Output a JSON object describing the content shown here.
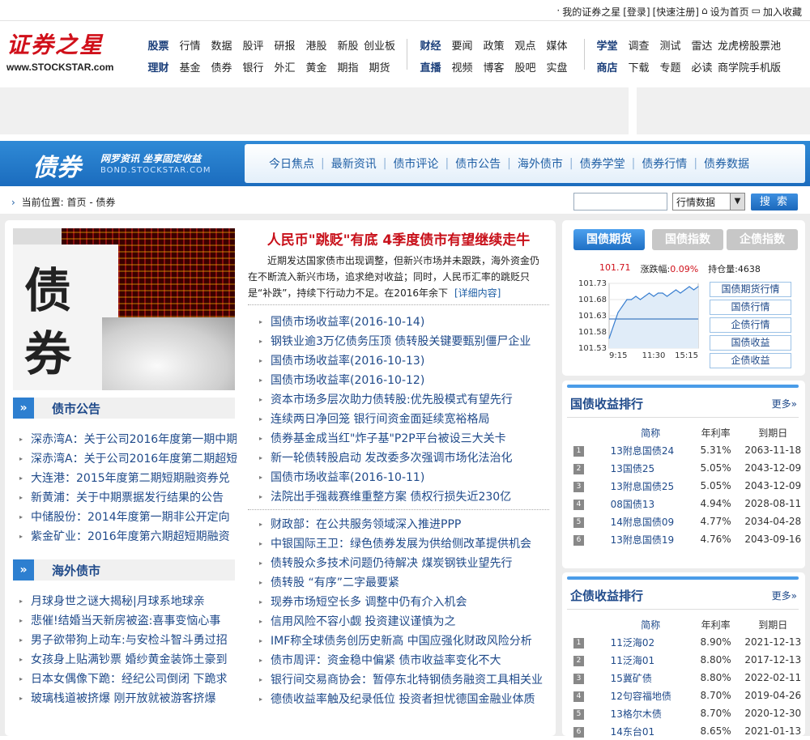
{
  "topbar": {
    "my_account": "我的证券之星",
    "login": "[登录]",
    "register": "[快速注册]",
    "set_home": "设为首页",
    "bookmark": "加入收藏"
  },
  "logo": {
    "name": "证券之星",
    "url": "www.STOCKSTAR.com"
  },
  "nav": {
    "group1": [
      {
        "label": "股票",
        "bold": true
      },
      {
        "label": "行情"
      },
      {
        "label": "数据"
      },
      {
        "label": "股评"
      },
      {
        "label": "研报"
      },
      {
        "label": "港股"
      },
      {
        "label": "新股"
      },
      {
        "label": "创业板"
      },
      {
        "label": "理财",
        "bold": true
      },
      {
        "label": "基金"
      },
      {
        "label": "债券"
      },
      {
        "label": "银行"
      },
      {
        "label": "外汇"
      },
      {
        "label": "黄金"
      },
      {
        "label": "期指"
      },
      {
        "label": "期货"
      }
    ],
    "group2": [
      {
        "label": "财经",
        "bold": true
      },
      {
        "label": "要闻"
      },
      {
        "label": "政策"
      },
      {
        "label": "观点"
      },
      {
        "label": "媒体"
      },
      {
        "label": "直播",
        "bold": true
      },
      {
        "label": "视频"
      },
      {
        "label": "博客"
      },
      {
        "label": "股吧"
      },
      {
        "label": "实盘"
      }
    ],
    "group3": [
      {
        "label": "学堂",
        "bold": true
      },
      {
        "label": "调查"
      },
      {
        "label": "测试"
      },
      {
        "label": "雷达"
      },
      {
        "label": "龙虎榜"
      },
      {
        "label": "股票池"
      },
      {
        "label": "商店",
        "bold": true
      },
      {
        "label": "下载"
      },
      {
        "label": "专题"
      },
      {
        "label": "必读"
      },
      {
        "label": "商学院"
      },
      {
        "label": "手机版"
      }
    ]
  },
  "channel": {
    "title": "债券",
    "slogan": "网罗资讯 坐享固定收益",
    "url": "BOND.STOCKSTAR.COM",
    "menu": [
      "今日焦点",
      "最新资讯",
      "债市评论",
      "债市公告",
      "海外债市",
      "债券学堂",
      "债券行情",
      "债券数据"
    ]
  },
  "breadcrumb": {
    "label": "当前位置:",
    "path": "首页 - 债券"
  },
  "search": {
    "placeholder": "",
    "select_value": "行情数据",
    "button": "搜 索"
  },
  "hero": {
    "headline": "人民币\"跳贬\"有底 4季度债市有望继续走牛",
    "summary": "近期发达国家债市出现调整，但新兴市场并未跟跌，海外资金仍在不断流入新兴市场，追求绝对收益；同时，人民币汇率的跳贬只是“补跌”，持续下行动力不足。在2016年余下",
    "more": "[详细内容]"
  },
  "news_top": [
    "国债市场收益率(2016-10-14)",
    "钢铁业逾3万亿债务压顶 债转股关键要甄别僵尸企业",
    "国债市场收益率(2016-10-13)",
    "国债市场收益率(2016-10-12)",
    "资本市场多层次助力债转股:优先股模式有望先行",
    "连续两日净回笼 银行间资金面延续宽裕格局",
    "债券基金成当红\"炸子基\"P2P平台被设三大关卡",
    "新一轮债转股启动 发改委多次强调市场化法治化",
    "国债市场收益率(2016-10-11)",
    "法院出手强裁赛维重整方案 债权行损失近230亿"
  ],
  "news_bottom": [
    "财政部：在公共服务领域深入推进PPP",
    "中银国际王卫：绿色债券发展为供给侧改革提供机会",
    "债转股众多技术问题仍待解决 煤炭钢铁业望先行",
    "债转股 “有序”二字最要紧",
    "现券市场短空长多 调整中仍有介入机会",
    "信用风险不容小觑 投资建议谨慎为之",
    "IMF称全球债务创历史新高 中国应强化财政风险分析",
    "债市周评：资金稳中偏紧 债市收益率变化不大",
    "银行间交易商协会：暂停东北特钢债务融资工具相关业",
    "德债收益率触及纪录低位 投资者担忧德国金融业体质"
  ],
  "announcements": {
    "title": "债市公告",
    "items": [
      "深赤湾A：关于公司2016年度第一期中期",
      "深赤湾A：关于公司2016年度第二期超短",
      "大连港：2015年度第二期短期融资券兑",
      "新黄浦：关于中期票据发行结果的公告",
      "中储股份：2014年度第一期非公开定向",
      "紫金矿业：2016年度第六期超短期融资"
    ]
  },
  "overseas": {
    "title": "海外债市",
    "items": [
      "月球身世之谜大揭秘|月球系地球亲",
      "悲催!结婚当天新房被盗:喜事变恼心事",
      "男子欲带狗上动车:与安检斗智斗勇过招",
      "女孩身上贴满钞票 婚纱黄金装饰土豪到",
      "日本女偶像下跪：经纪公司倒闭 下跪求",
      "玻璃栈道被挤爆 刚开放就被游客挤爆"
    ]
  },
  "quote": {
    "tabs": [
      "国债期货",
      "国债指数",
      "企债指数"
    ],
    "price": "101.71",
    "change_label": "涨跌幅:",
    "change": "0.09%",
    "oi_label": "持仓量:",
    "oi": "4638",
    "links": [
      "国债期货行情",
      "国债行情",
      "企债行情",
      "国债收益",
      "企债收益"
    ]
  },
  "chart_data": {
    "type": "line",
    "title": "",
    "y_ticks": [
      "101.73",
      "101.68",
      "101.63",
      "101.58",
      "101.53"
    ],
    "ylim": [
      101.53,
      101.73
    ],
    "x_ticks": [
      "9:15",
      "11:30",
      "15:15"
    ],
    "reference": 101.62,
    "x": [
      0,
      5,
      10,
      15,
      20,
      25,
      30,
      35,
      40,
      45,
      50,
      55,
      60,
      65,
      70,
      75,
      80,
      85,
      90,
      95,
      100
    ],
    "values": [
      101.56,
      101.6,
      101.64,
      101.66,
      101.68,
      101.68,
      101.69,
      101.68,
      101.69,
      101.7,
      101.69,
      101.7,
      101.7,
      101.69,
      101.7,
      101.71,
      101.7,
      101.71,
      101.72,
      101.71,
      101.72
    ],
    "colors": {
      "line": "#3a7fd0",
      "fill": "#e0ecf8",
      "ref": "#1a5fb4"
    }
  },
  "gov_rank": {
    "title": "国债收益排行",
    "more": "更多»",
    "headers": [
      "简称",
      "年利率",
      "到期日"
    ],
    "rows": [
      {
        "n": "1",
        "name": "13附息国债24",
        "rate": "5.31%",
        "date": "2063-11-18"
      },
      {
        "n": "2",
        "name": "13国债25",
        "rate": "5.05%",
        "date": "2043-12-09"
      },
      {
        "n": "3",
        "name": "13附息国债25",
        "rate": "5.05%",
        "date": "2043-12-09"
      },
      {
        "n": "4",
        "name": "08国债13",
        "rate": "4.94%",
        "date": "2028-08-11"
      },
      {
        "n": "5",
        "name": "14附息国债09",
        "rate": "4.77%",
        "date": "2034-04-28"
      },
      {
        "n": "6",
        "name": "13附息国债19",
        "rate": "4.76%",
        "date": "2043-09-16"
      }
    ]
  },
  "corp_rank": {
    "title": "企债收益排行",
    "more": "更多»",
    "headers": [
      "简称",
      "年利率",
      "到期日"
    ],
    "rows": [
      {
        "n": "1",
        "name": "11泛海02",
        "rate": "8.90%",
        "date": "2021-12-13"
      },
      {
        "n": "2",
        "name": "11泛海01",
        "rate": "8.80%",
        "date": "2017-12-13"
      },
      {
        "n": "3",
        "name": "15冀矿债",
        "rate": "8.80%",
        "date": "2022-02-11"
      },
      {
        "n": "4",
        "name": "12句容福地债",
        "rate": "8.70%",
        "date": "2019-04-26"
      },
      {
        "n": "5",
        "name": "13格尔木债",
        "rate": "8.70%",
        "date": "2020-12-30"
      },
      {
        "n": "6",
        "name": "14东台01",
        "rate": "8.65%",
        "date": "2021-01-13"
      }
    ]
  }
}
